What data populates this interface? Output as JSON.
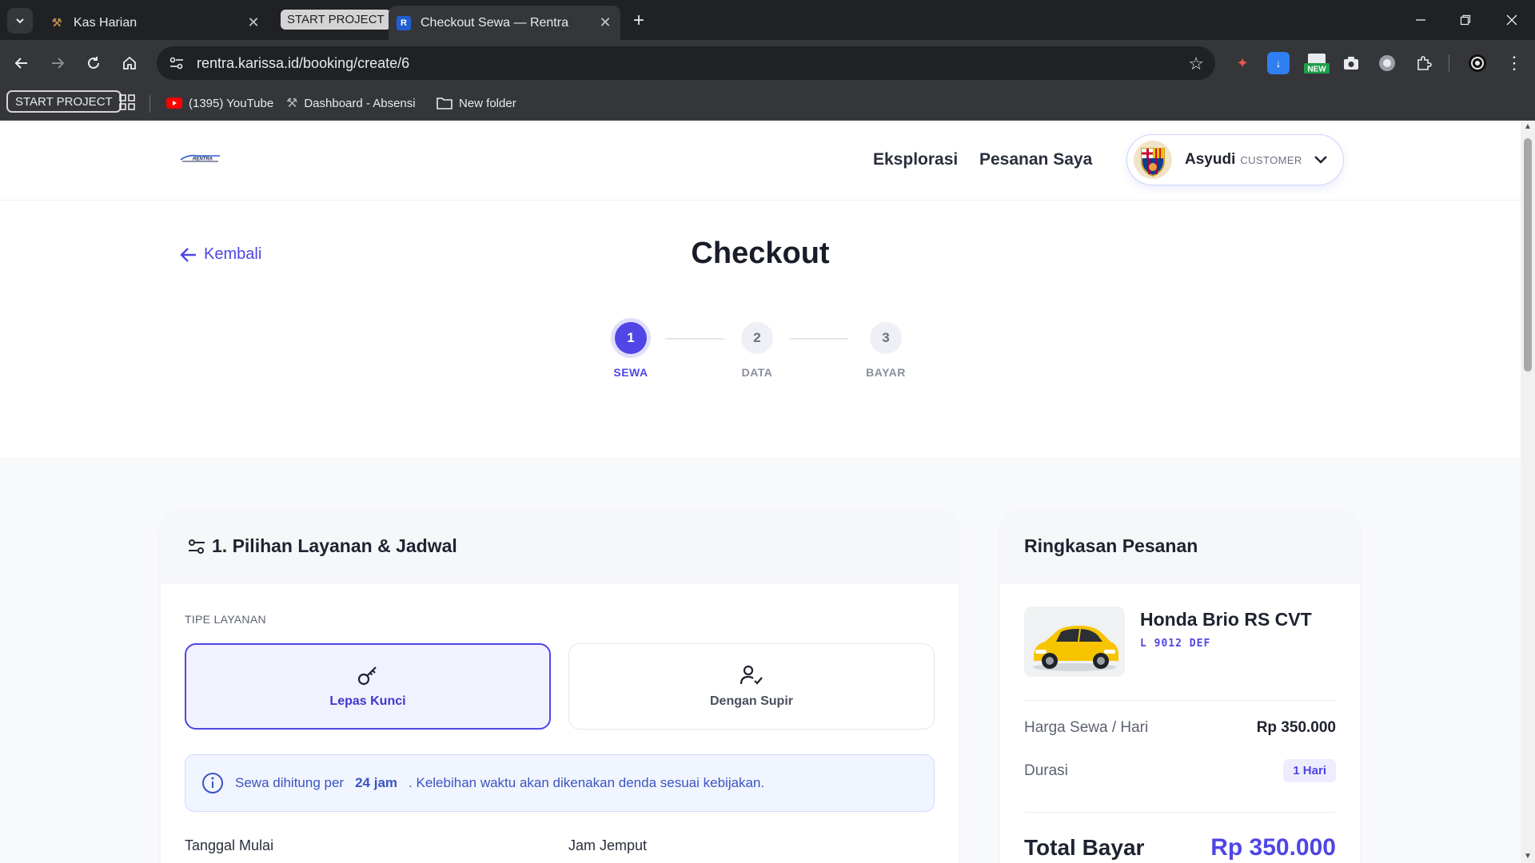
{
  "browser": {
    "tabs": [
      {
        "title": "Kas Harian",
        "active": false
      },
      {
        "title": "Checkout Sewa — Rentra",
        "active": true
      }
    ],
    "tab_group_label": "START PROJECT",
    "url": "rentra.karissa.id/booking/create/6",
    "extensions": {
      "new_badge": "NEW"
    },
    "bookmarks": {
      "group_label": "START PROJECT",
      "items": [
        {
          "label": "(1395) YouTube",
          "icon": "youtube-icon"
        },
        {
          "label": "Dashboard - Absensi",
          "icon": "absensi-icon"
        },
        {
          "label": "New folder",
          "icon": "folder-icon"
        }
      ]
    }
  },
  "header": {
    "logo_text": "RENTRA",
    "nav": [
      "Eksplorasi",
      "Pesanan Saya"
    ],
    "profile": {
      "name": "Asyudi",
      "role": "CUSTOMER"
    }
  },
  "checkout": {
    "back_label": "Kembali",
    "title": "Checkout",
    "steps": [
      {
        "number": "1",
        "label": "SEWA",
        "active": true
      },
      {
        "number": "2",
        "label": "DATA",
        "active": false
      },
      {
        "number": "3",
        "label": "BAYAR",
        "active": false
      }
    ]
  },
  "main_card": {
    "title": "1. Pilihan Layanan & Jadwal",
    "service_type_label": "TIPE LAYANAN",
    "options": [
      {
        "label": "Lepas Kunci",
        "selected": true,
        "icon": "key-icon"
      },
      {
        "label": "Dengan Supir",
        "selected": false,
        "icon": "user-check-icon"
      }
    ],
    "info": {
      "prefix": "Sewa dihitung per",
      "highlight": "24 jam",
      "suffix": ". Kelebihan waktu akan dikenakan denda sesuai kebijakan."
    },
    "fields": {
      "start_date_label": "Tanggal Mulai",
      "pickup_time_label": "Jam Jemput"
    }
  },
  "summary": {
    "title": "Ringkasan Pesanan",
    "car": {
      "name": "Honda Brio RS CVT",
      "plate": "L 9012 DEF"
    },
    "price_label": "Harga Sewa / Hari",
    "price_value": "Rp 350.000",
    "duration_label": "Durasi",
    "duration_value": "1 Hari",
    "total_label": "Total Bayar",
    "total_value": "Rp 350.000"
  },
  "colors": {
    "accent": "#4f46e5",
    "chrome_dark": "#202124",
    "chrome_toolbar": "#35363a"
  }
}
